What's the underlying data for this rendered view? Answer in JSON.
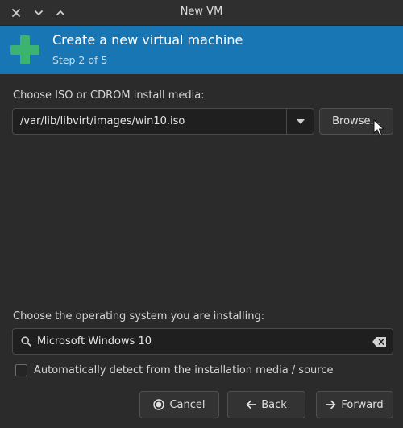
{
  "window": {
    "title": "New VM",
    "controls": [
      "close-icon",
      "minimize-icon",
      "maximize-icon"
    ]
  },
  "header": {
    "title": "Create a new virtual machine",
    "step": "Step 2 of 5",
    "icon": "plus-icon",
    "accent_color": "#1976b5",
    "icon_color": "#3cb371"
  },
  "install_media": {
    "label": "Choose ISO or CDROM install media:",
    "value": "/var/lib/libvirt/images/win10.iso",
    "browse_label": "Browse..."
  },
  "os": {
    "label": "Choose the operating system you are installing:",
    "search_value": "Microsoft Windows 10",
    "autodetect_label": "Automatically detect from the installation media / source",
    "autodetect_checked": false
  },
  "buttons": {
    "cancel": "Cancel",
    "back": "Back",
    "forward": "Forward"
  }
}
